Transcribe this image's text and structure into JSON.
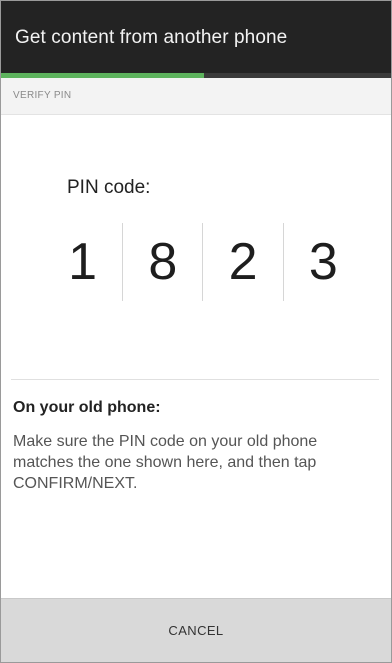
{
  "app": {
    "title": "Get content from another phone"
  },
  "progress": {
    "fraction": 0.52,
    "color": "#5db35d"
  },
  "step": {
    "label": "VERIFY PIN"
  },
  "pin": {
    "heading": "PIN code:",
    "digits": [
      "1",
      "8",
      "2",
      "3"
    ]
  },
  "instructions": {
    "title": "On your old phone:",
    "body": "Make sure the PIN code on your old phone matches the one shown here, and then tap CONFIRM/NEXT."
  },
  "footer": {
    "cancel_label": "CANCEL"
  }
}
